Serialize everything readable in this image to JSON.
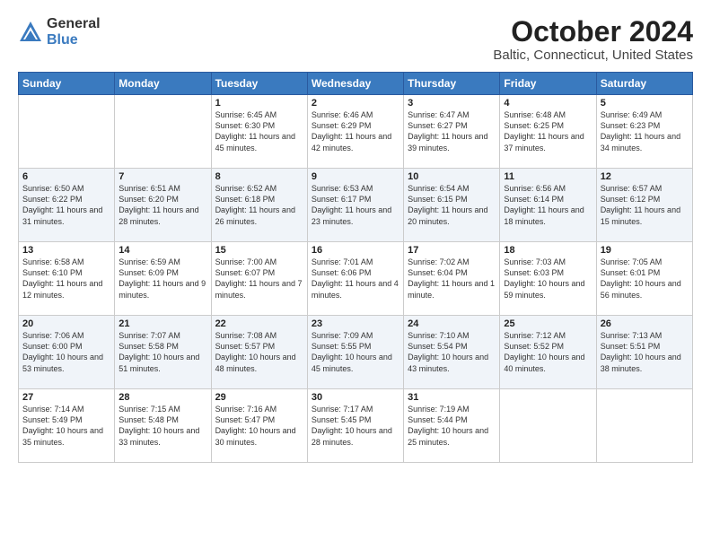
{
  "logo": {
    "general": "General",
    "blue": "Blue"
  },
  "header": {
    "month": "October 2024",
    "location": "Baltic, Connecticut, United States"
  },
  "days_of_week": [
    "Sunday",
    "Monday",
    "Tuesday",
    "Wednesday",
    "Thursday",
    "Friday",
    "Saturday"
  ],
  "weeks": [
    [
      {
        "num": "",
        "info": ""
      },
      {
        "num": "",
        "info": ""
      },
      {
        "num": "1",
        "info": "Sunrise: 6:45 AM\nSunset: 6:30 PM\nDaylight: 11 hours and 45 minutes."
      },
      {
        "num": "2",
        "info": "Sunrise: 6:46 AM\nSunset: 6:29 PM\nDaylight: 11 hours and 42 minutes."
      },
      {
        "num": "3",
        "info": "Sunrise: 6:47 AM\nSunset: 6:27 PM\nDaylight: 11 hours and 39 minutes."
      },
      {
        "num": "4",
        "info": "Sunrise: 6:48 AM\nSunset: 6:25 PM\nDaylight: 11 hours and 37 minutes."
      },
      {
        "num": "5",
        "info": "Sunrise: 6:49 AM\nSunset: 6:23 PM\nDaylight: 11 hours and 34 minutes."
      }
    ],
    [
      {
        "num": "6",
        "info": "Sunrise: 6:50 AM\nSunset: 6:22 PM\nDaylight: 11 hours and 31 minutes."
      },
      {
        "num": "7",
        "info": "Sunrise: 6:51 AM\nSunset: 6:20 PM\nDaylight: 11 hours and 28 minutes."
      },
      {
        "num": "8",
        "info": "Sunrise: 6:52 AM\nSunset: 6:18 PM\nDaylight: 11 hours and 26 minutes."
      },
      {
        "num": "9",
        "info": "Sunrise: 6:53 AM\nSunset: 6:17 PM\nDaylight: 11 hours and 23 minutes."
      },
      {
        "num": "10",
        "info": "Sunrise: 6:54 AM\nSunset: 6:15 PM\nDaylight: 11 hours and 20 minutes."
      },
      {
        "num": "11",
        "info": "Sunrise: 6:56 AM\nSunset: 6:14 PM\nDaylight: 11 hours and 18 minutes."
      },
      {
        "num": "12",
        "info": "Sunrise: 6:57 AM\nSunset: 6:12 PM\nDaylight: 11 hours and 15 minutes."
      }
    ],
    [
      {
        "num": "13",
        "info": "Sunrise: 6:58 AM\nSunset: 6:10 PM\nDaylight: 11 hours and 12 minutes."
      },
      {
        "num": "14",
        "info": "Sunrise: 6:59 AM\nSunset: 6:09 PM\nDaylight: 11 hours and 9 minutes."
      },
      {
        "num": "15",
        "info": "Sunrise: 7:00 AM\nSunset: 6:07 PM\nDaylight: 11 hours and 7 minutes."
      },
      {
        "num": "16",
        "info": "Sunrise: 7:01 AM\nSunset: 6:06 PM\nDaylight: 11 hours and 4 minutes."
      },
      {
        "num": "17",
        "info": "Sunrise: 7:02 AM\nSunset: 6:04 PM\nDaylight: 11 hours and 1 minute."
      },
      {
        "num": "18",
        "info": "Sunrise: 7:03 AM\nSunset: 6:03 PM\nDaylight: 10 hours and 59 minutes."
      },
      {
        "num": "19",
        "info": "Sunrise: 7:05 AM\nSunset: 6:01 PM\nDaylight: 10 hours and 56 minutes."
      }
    ],
    [
      {
        "num": "20",
        "info": "Sunrise: 7:06 AM\nSunset: 6:00 PM\nDaylight: 10 hours and 53 minutes."
      },
      {
        "num": "21",
        "info": "Sunrise: 7:07 AM\nSunset: 5:58 PM\nDaylight: 10 hours and 51 minutes."
      },
      {
        "num": "22",
        "info": "Sunrise: 7:08 AM\nSunset: 5:57 PM\nDaylight: 10 hours and 48 minutes."
      },
      {
        "num": "23",
        "info": "Sunrise: 7:09 AM\nSunset: 5:55 PM\nDaylight: 10 hours and 45 minutes."
      },
      {
        "num": "24",
        "info": "Sunrise: 7:10 AM\nSunset: 5:54 PM\nDaylight: 10 hours and 43 minutes."
      },
      {
        "num": "25",
        "info": "Sunrise: 7:12 AM\nSunset: 5:52 PM\nDaylight: 10 hours and 40 minutes."
      },
      {
        "num": "26",
        "info": "Sunrise: 7:13 AM\nSunset: 5:51 PM\nDaylight: 10 hours and 38 minutes."
      }
    ],
    [
      {
        "num": "27",
        "info": "Sunrise: 7:14 AM\nSunset: 5:49 PM\nDaylight: 10 hours and 35 minutes."
      },
      {
        "num": "28",
        "info": "Sunrise: 7:15 AM\nSunset: 5:48 PM\nDaylight: 10 hours and 33 minutes."
      },
      {
        "num": "29",
        "info": "Sunrise: 7:16 AM\nSunset: 5:47 PM\nDaylight: 10 hours and 30 minutes."
      },
      {
        "num": "30",
        "info": "Sunrise: 7:17 AM\nSunset: 5:45 PM\nDaylight: 10 hours and 28 minutes."
      },
      {
        "num": "31",
        "info": "Sunrise: 7:19 AM\nSunset: 5:44 PM\nDaylight: 10 hours and 25 minutes."
      },
      {
        "num": "",
        "info": ""
      },
      {
        "num": "",
        "info": ""
      }
    ]
  ]
}
